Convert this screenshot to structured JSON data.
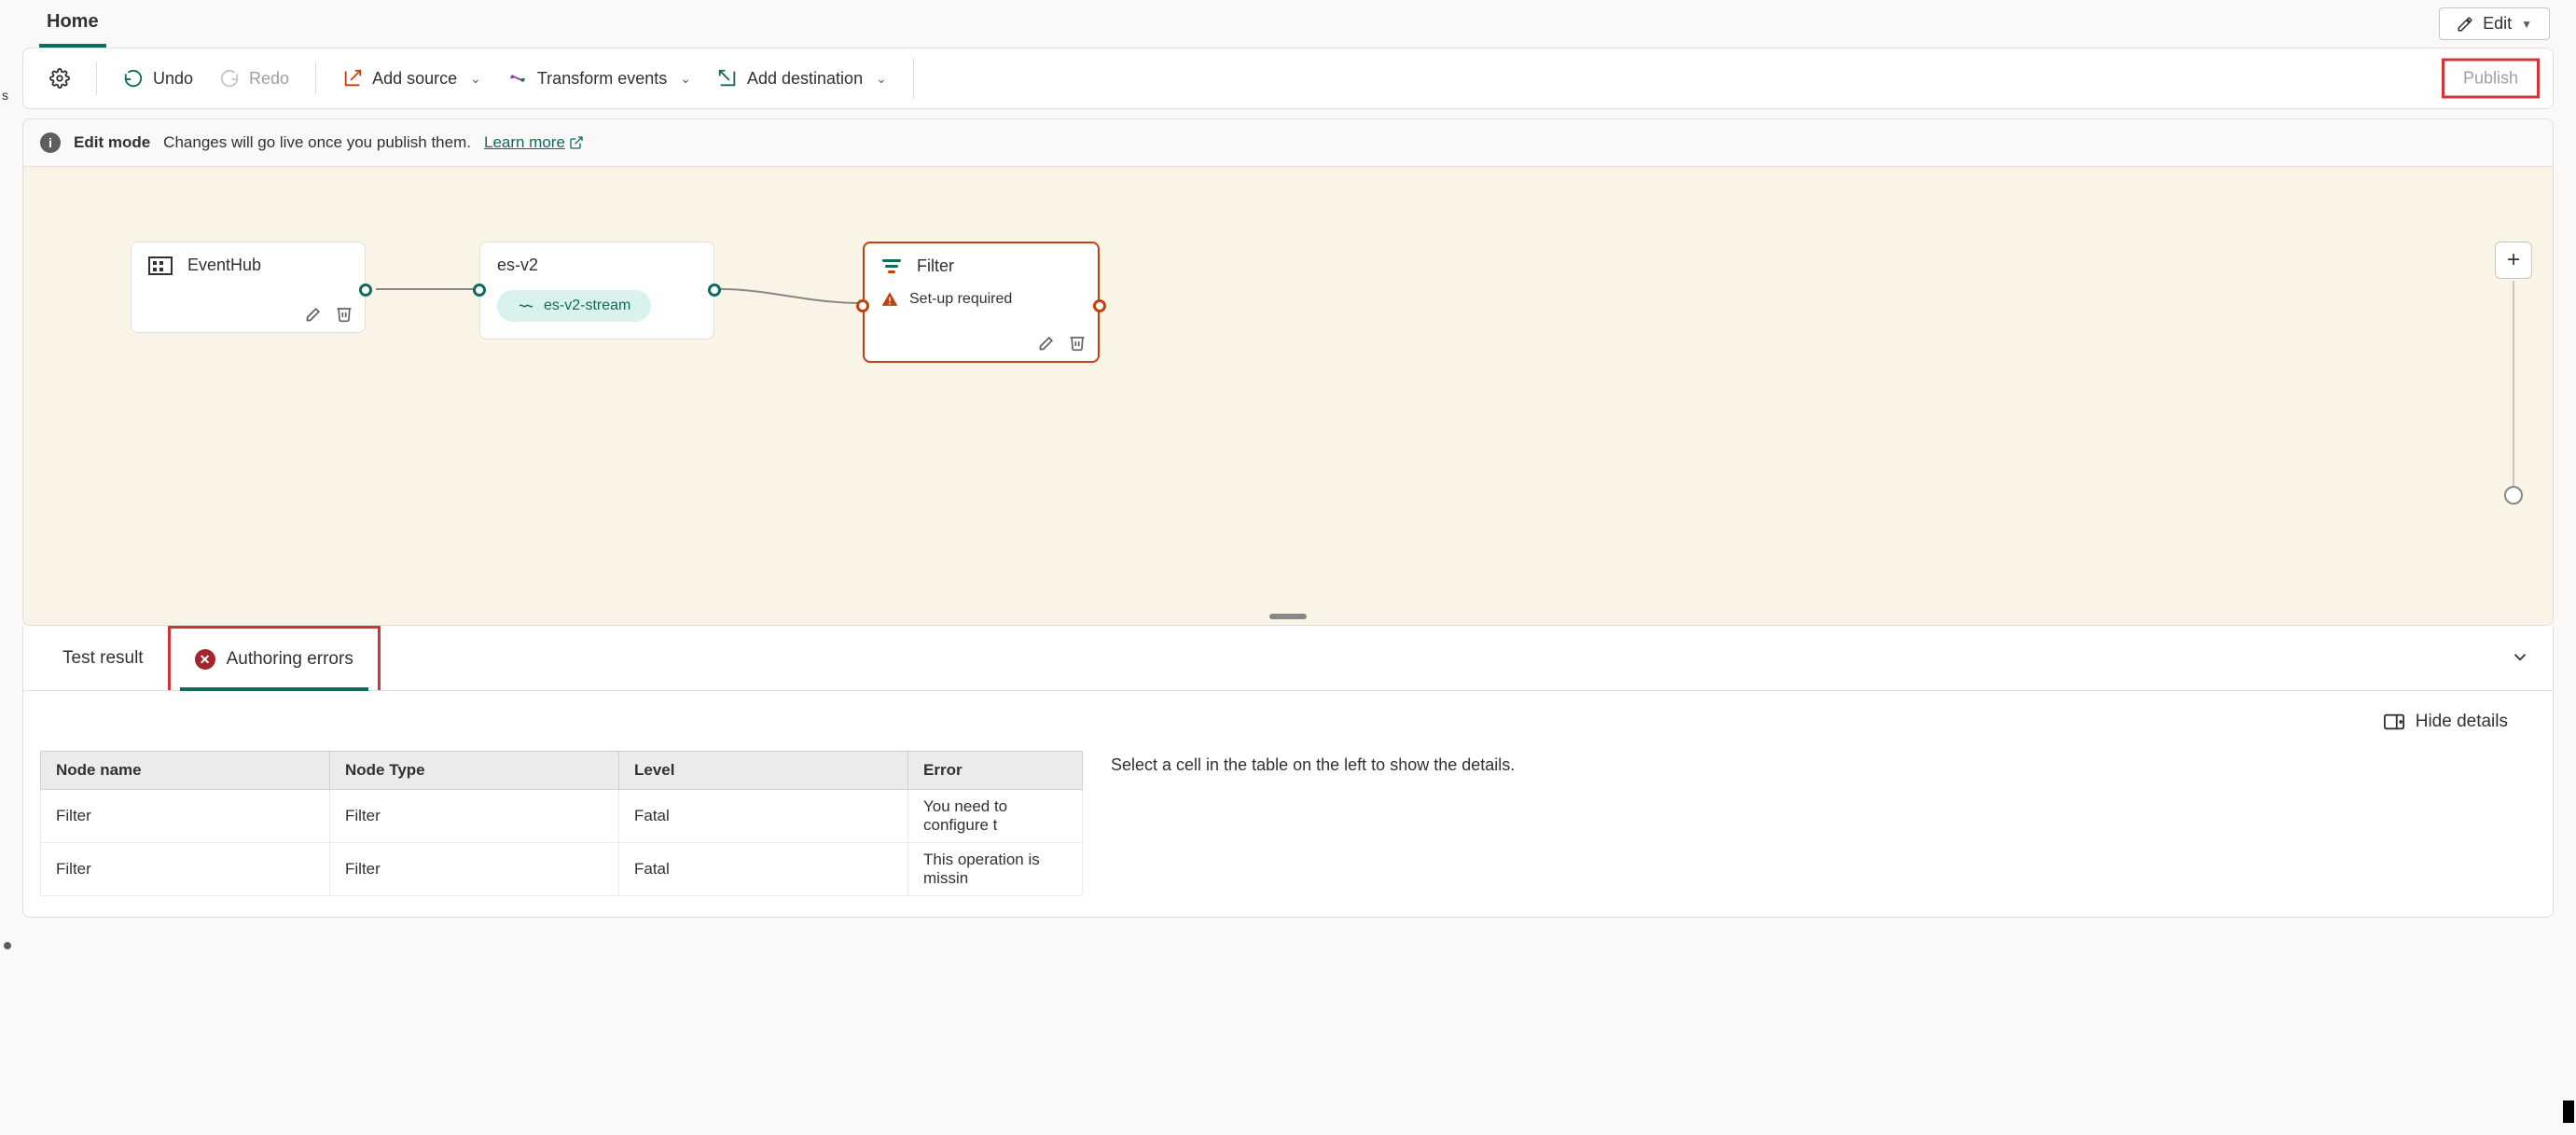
{
  "header": {
    "home_tab": "Home",
    "edit_label": "Edit"
  },
  "toolbar": {
    "undo": "Undo",
    "redo": "Redo",
    "add_source": "Add source",
    "transform": "Transform events",
    "add_dest": "Add destination",
    "publish": "Publish"
  },
  "banner": {
    "mode": "Edit mode",
    "msg": "Changes will go live once you publish them.",
    "learn": "Learn more"
  },
  "nodes": {
    "eventhub": {
      "title": "EventHub"
    },
    "esv2": {
      "title": "es-v2",
      "stream": "es-v2-stream"
    },
    "filter": {
      "title": "Filter",
      "warn": "Set-up required"
    }
  },
  "panel": {
    "tab_test": "Test result",
    "tab_err": "Authoring errors",
    "hide": "Hide details",
    "detail_text": "Select a cell in the table on the left to show the details."
  },
  "table": {
    "headers": {
      "node_name": "Node name",
      "node_type": "Node Type",
      "level": "Level",
      "error": "Error"
    },
    "rows": [
      {
        "name": "Filter",
        "type": "Filter",
        "level": "Fatal",
        "error": "You need to configure t"
      },
      {
        "name": "Filter",
        "type": "Filter",
        "level": "Fatal",
        "error": "This operation is missin"
      }
    ]
  },
  "misc": {
    "left_s": "s"
  }
}
